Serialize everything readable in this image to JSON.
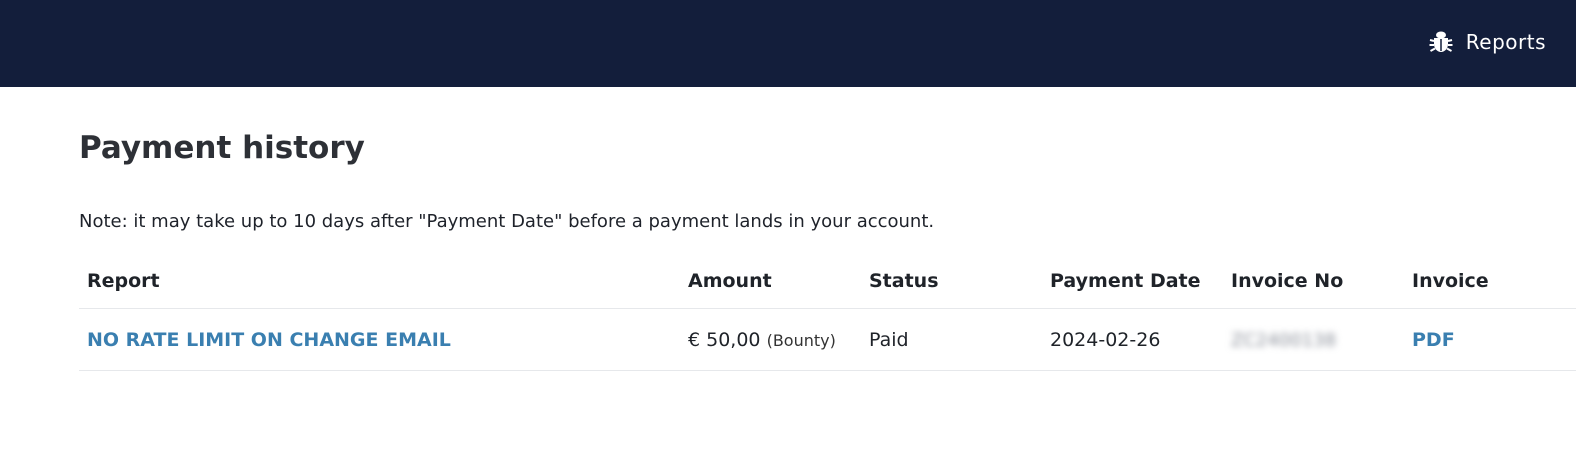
{
  "header": {
    "nav_reports_label": "Reports",
    "nav_reports_icon": "bug-icon",
    "background": "#131e3b"
  },
  "page": {
    "title": "Payment history",
    "note": "Note: it may take up to 10 days after \"Payment Date\" before a payment lands in your account."
  },
  "table": {
    "headers": {
      "report": "Report",
      "amount": "Amount",
      "status": "Status",
      "payment_date": "Payment Date",
      "invoice_no": "Invoice No",
      "invoice": "Invoice"
    },
    "rows": [
      {
        "report": "NO RATE LIMIT ON CHANGE EMAIL",
        "amount": "€ 50,00",
        "amount_type": "(Bounty)",
        "status": "Paid",
        "payment_date": "2024-02-26",
        "invoice_no": "ZC2400138",
        "invoice": "PDF"
      }
    ]
  },
  "colors": {
    "link": "#3a7fb0",
    "divider": "#e6e8eb"
  }
}
